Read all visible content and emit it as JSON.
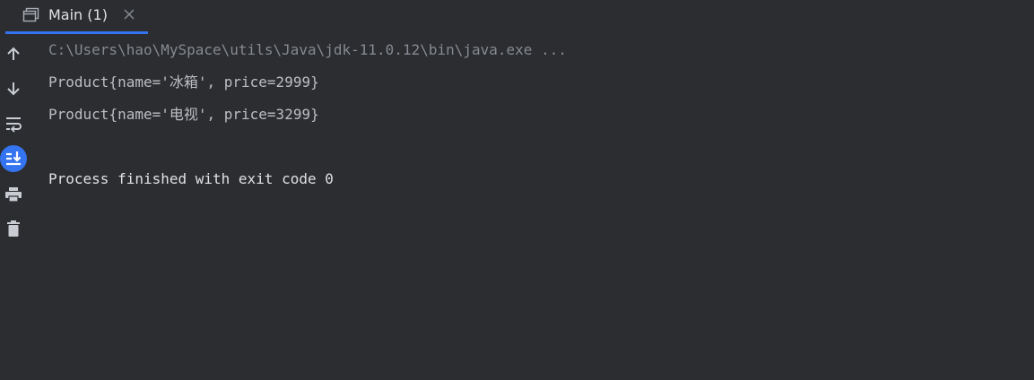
{
  "tab": {
    "label": "Main (1)",
    "icon": "console-window-icon",
    "close": "×"
  },
  "toolbar": {
    "items": [
      {
        "icon": "arrow-up-icon",
        "tooltip": "Up the Stack Trace"
      },
      {
        "icon": "arrow-down-icon",
        "tooltip": "Down the Stack Trace"
      },
      {
        "icon": "soft-wrap-icon",
        "tooltip": "Soft-Wrap"
      },
      {
        "icon": "scroll-to-end-icon",
        "tooltip": "Scroll to End",
        "active": true
      },
      {
        "icon": "print-icon",
        "tooltip": "Print"
      },
      {
        "icon": "trash-icon",
        "tooltip": "Clear All"
      }
    ]
  },
  "console": {
    "command": "C:\\Users\\hao\\MySpace\\utils\\Java\\jdk-11.0.12\\bin\\java.exe ...",
    "lines": [
      "Product{name='冰箱', price=2999}",
      "Product{name='电视', price=3299}"
    ],
    "finish": "Process finished with exit code 0"
  },
  "colors": {
    "background": "#2b2d30",
    "accent": "#3574f0",
    "command_text": "#868a91",
    "output_text": "#bcbec4"
  }
}
